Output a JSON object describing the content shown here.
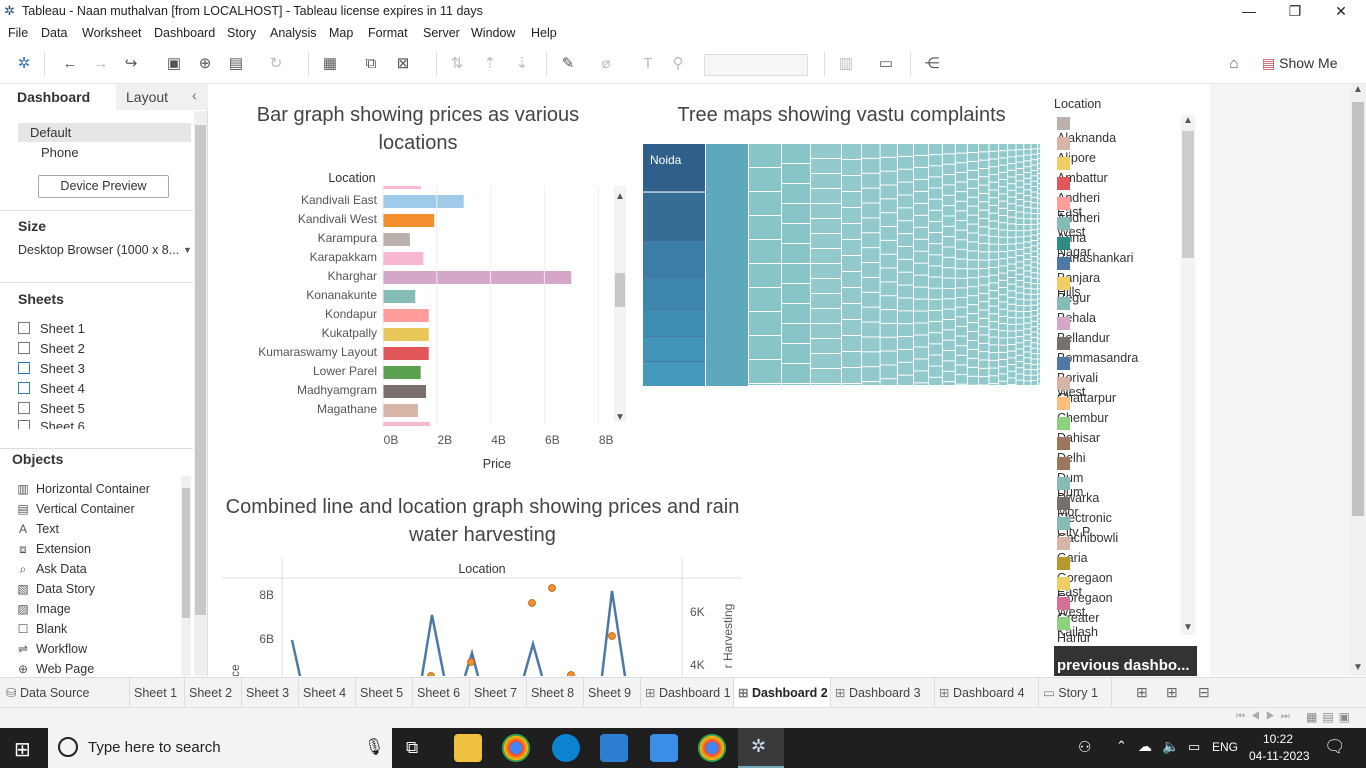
{
  "window": {
    "title": "Tableau - Naan muthalvan [from LOCALHOST] - Tableau license expires in 11 days"
  },
  "menu": [
    "File",
    "Data",
    "Worksheet",
    "Dashboard",
    "Story",
    "Analysis",
    "Map",
    "Format",
    "Server",
    "Window",
    "Help"
  ],
  "toolbar": {
    "show_me": "Show Me"
  },
  "left_panel": {
    "tabs": {
      "dashboard": "Dashboard",
      "layout": "Layout"
    },
    "devices": [
      "Default",
      "Phone"
    ],
    "device_preview": "Device Preview",
    "size_label": "Size",
    "size_value": "Desktop Browser (1000 x 8...",
    "sheets_label": "Sheets",
    "sheets": [
      "Sheet 1",
      "Sheet 2",
      "Sheet 3",
      "Sheet 4",
      "Sheet 5",
      "Sheet 6"
    ],
    "objects_label": "Objects",
    "objects": [
      {
        "label": "Horizontal Container",
        "icon": "horizontal-container-icon"
      },
      {
        "label": "Vertical Container",
        "icon": "vertical-container-icon"
      },
      {
        "label": "Text",
        "icon": "text-icon"
      },
      {
        "label": "Extension",
        "icon": "extension-icon"
      },
      {
        "label": "Ask Data",
        "icon": "ask-data-icon"
      },
      {
        "label": "Data Story",
        "icon": "data-story-icon"
      },
      {
        "label": "Image",
        "icon": "image-icon"
      },
      {
        "label": "Blank",
        "icon": "blank-icon"
      },
      {
        "label": "Workflow",
        "icon": "workflow-icon"
      },
      {
        "label": "Web Page",
        "icon": "web-page-icon"
      }
    ]
  },
  "dashboard": {
    "bar_title": "Bar graph showing prices as various locations",
    "tree_title": "Tree maps  showing vastu complaints",
    "combo_title": "Combined line and location graph showing prices and rain water harvesting",
    "tree_label": "Noida",
    "prev_button": "previous dashbo..."
  },
  "chart_data": [
    {
      "type": "bar",
      "title": "Bar graph showing prices as various locations",
      "ylabel": "Location",
      "xlabel": "Price",
      "categories": [
        "Kandivali East",
        "Kandivali West",
        "Karampura",
        "Karapakkam",
        "Kharghar",
        "Konanakunte",
        "Kondapur",
        "Kukatpally",
        "Kumaraswamy Layout",
        "Lower Parel",
        "Madhyamgram",
        "Magathane"
      ],
      "values": [
        3.0,
        1.9,
        1.0,
        1.5,
        7.0,
        1.2,
        1.7,
        1.7,
        1.7,
        1.4,
        1.6,
        1.3
      ],
      "value_unit": "B",
      "colors": [
        "#a0cbe8",
        "#f28e2b",
        "#bab0ac",
        "#f7b6d2",
        "#d4a6c8",
        "#86bcb6",
        "#ff9d9a",
        "#e8c85a",
        "#e15759",
        "#59a14f",
        "#79706e",
        "#d7b5a6"
      ],
      "xticks": [
        "0B",
        "2B",
        "4B",
        "6B",
        "8B"
      ],
      "xlim": [
        0,
        8
      ]
    },
    {
      "type": "line",
      "title": "Combined line and location graph showing prices and rain water harvesting",
      "xlabel": "Location",
      "yticks_left": [
        "6B",
        "8B"
      ],
      "yticks_right": [
        "4K",
        "6K"
      ]
    }
  ],
  "legend": {
    "title": "Location",
    "items": [
      {
        "label": "Alaknanda",
        "color": "#bab0ac"
      },
      {
        "label": "Alipore",
        "color": "#d7b5a6"
      },
      {
        "label": "Ambattur",
        "color": "#f1ce63"
      },
      {
        "label": "Andheri East",
        "color": "#e15759"
      },
      {
        "label": "Andheri West",
        "color": "#ff9d9a"
      },
      {
        "label": "Anna Nagar",
        "color": "#86bcb6"
      },
      {
        "label": "Banashankari",
        "color": "#2e8b84"
      },
      {
        "label": "Banjara Hills",
        "color": "#4e79a7"
      },
      {
        "label": "Begur",
        "color": "#f1ce63"
      },
      {
        "label": "Behala",
        "color": "#86bcb6"
      },
      {
        "label": "Bellandur",
        "color": "#d4a6c8"
      },
      {
        "label": "Bommasandra",
        "color": "#79706e"
      },
      {
        "label": "Borivali West",
        "color": "#4e79a7"
      },
      {
        "label": "Chattarpur",
        "color": "#d7b5a6"
      },
      {
        "label": "Chembur",
        "color": "#ffbe7d"
      },
      {
        "label": "Dahisar",
        "color": "#8cd17d"
      },
      {
        "label": "Delhi",
        "color": "#9d7660"
      },
      {
        "label": "Dum Dum",
        "color": "#9d7660"
      },
      {
        "label": "Dwarka Mor",
        "color": "#86bcb6"
      },
      {
        "label": "Electronic City P...",
        "color": "#79706e"
      },
      {
        "label": "Gachibowli",
        "color": "#86bcb6"
      },
      {
        "label": "Garia",
        "color": "#d7b5a6"
      },
      {
        "label": "Goregaon East",
        "color": "#b6992d"
      },
      {
        "label": "Goregaon West",
        "color": "#f1ce63"
      },
      {
        "label": "Greater Kailash",
        "color": "#d37295"
      },
      {
        "label": "Harlur",
        "color": "#8cd17d"
      }
    ]
  },
  "tabs": [
    "Data Source",
    "Sheet 1",
    "Sheet 2",
    "Sheet 3",
    "Sheet 4",
    "Sheet 5",
    "Sheet 6",
    "Sheet 7",
    "Sheet 8",
    "Sheet 9",
    "Dashboard 1",
    "Dashboard 2",
    "Dashboard 3",
    "Dashboard 4",
    "Story 1"
  ],
  "active_tab": "Dashboard 2",
  "taskbar": {
    "search_placeholder": "Type here to search",
    "lang": "ENG",
    "time": "10:22",
    "date": "04-11-2023"
  }
}
